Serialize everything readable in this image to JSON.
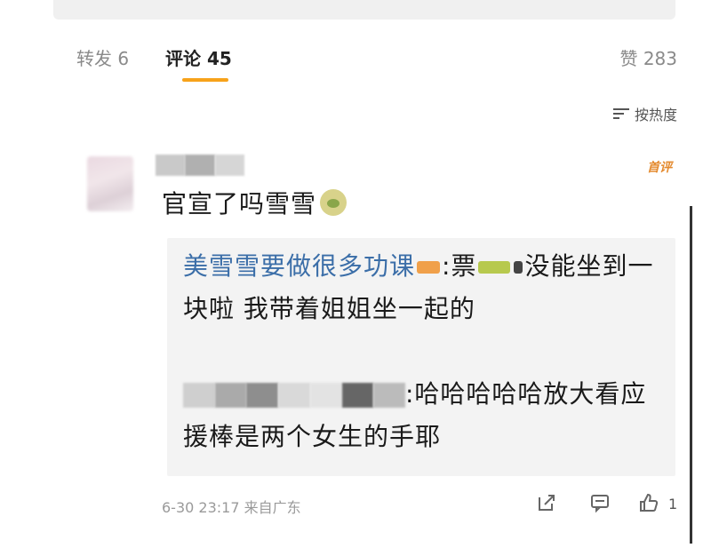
{
  "tabs": {
    "repost_label": "转发 6",
    "comment_label": "评论 45",
    "like_label": "赞 283"
  },
  "sort": {
    "label": "按热度"
  },
  "comment": {
    "badge": "首评",
    "text": "官宣了吗雪雪",
    "emoji": "crying-face-icon",
    "replies": [
      {
        "user": "美雪雪要做很多功课",
        "text_part1": ":票",
        "text_part2": "没能坐到一块啦 我带着姐姐坐一起的"
      },
      {
        "text": ":哈哈哈哈哈放大看应援棒是两个女生的手耶"
      }
    ],
    "meta": "6-30 23:17 来自广东",
    "like_count": "1"
  },
  "colors": {
    "accent": "#f7a21a",
    "reply_user": "#3b6ea8",
    "badge": "#e48a2e"
  }
}
